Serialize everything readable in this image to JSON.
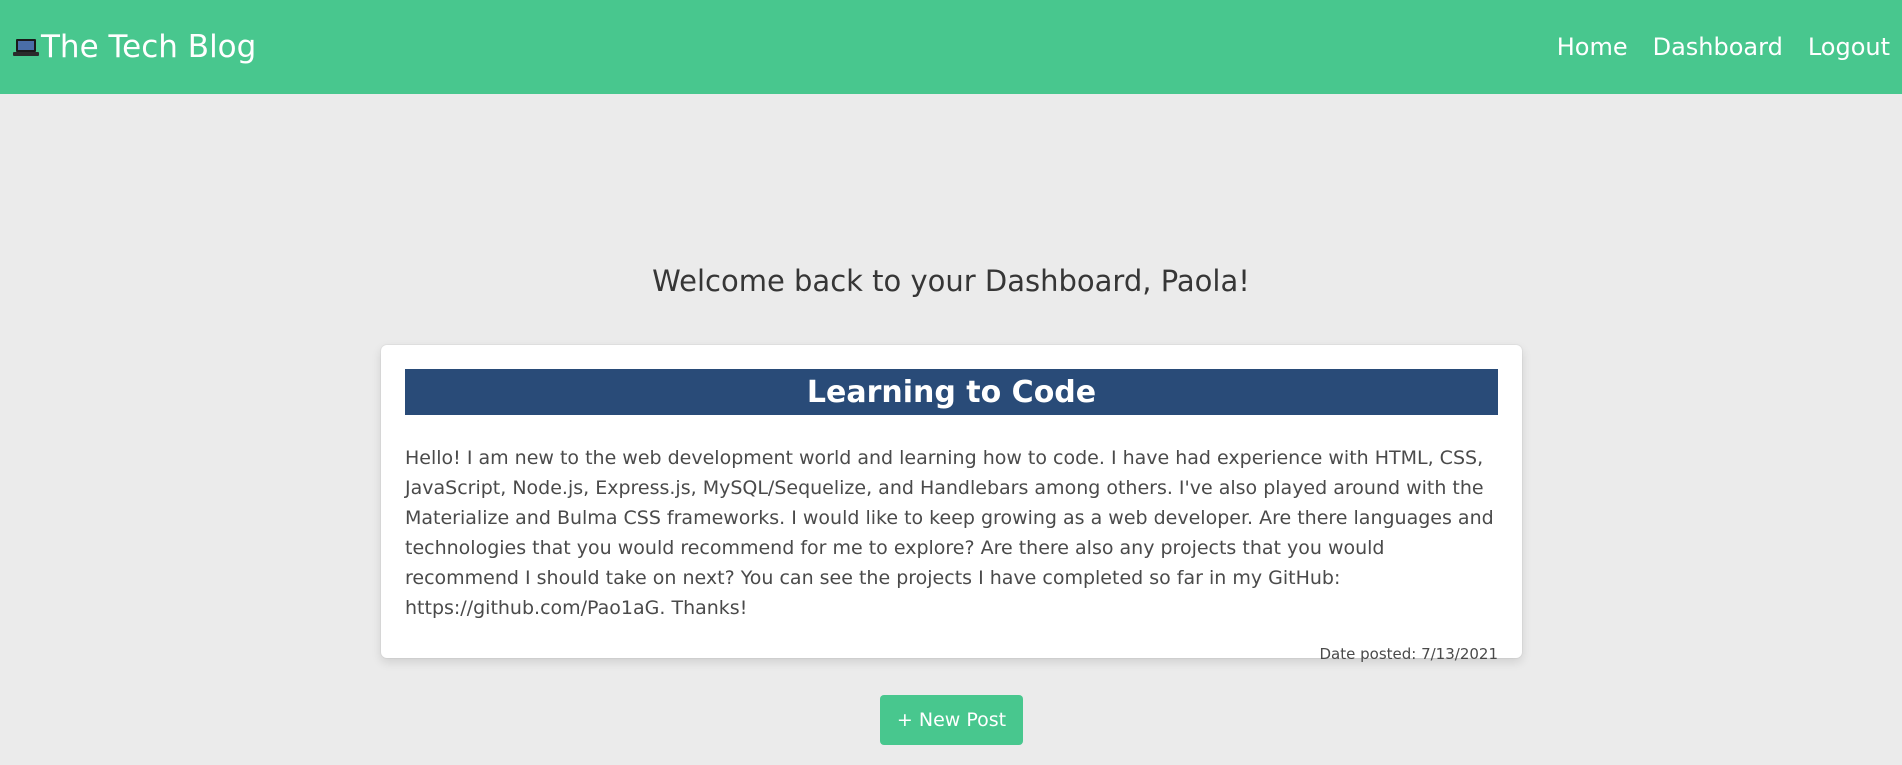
{
  "navbar": {
    "brand": "The Tech Blog",
    "links": [
      {
        "label": "Home"
      },
      {
        "label": "Dashboard"
      },
      {
        "label": "Logout"
      }
    ],
    "background_color": "#48c78e"
  },
  "main": {
    "welcome": "Welcome back to your Dashboard, Paola!",
    "post": {
      "title": "Learning to Code",
      "body": "Hello! I am new to the web development world and learning how to code. I have had experience with HTML, CSS, JavaScript, Node.js, Express.js, MySQL/Sequelize, and Handlebars among others. I've also played around with the Materialize and Bulma CSS frameworks. I would like to keep growing as a web developer. Are there languages and technologies that you would recommend for me to explore? Are there also any projects that you would recommend I should take on next? You can see the projects I have completed so far in my GitHub: https://github.com/Pao1aG. Thanks!",
      "date": "Date posted: 7/13/2021",
      "title_background": "#294b78"
    },
    "new_post_label": "+ New Post"
  },
  "icons": {
    "brand_icon": "laptop-icon"
  }
}
